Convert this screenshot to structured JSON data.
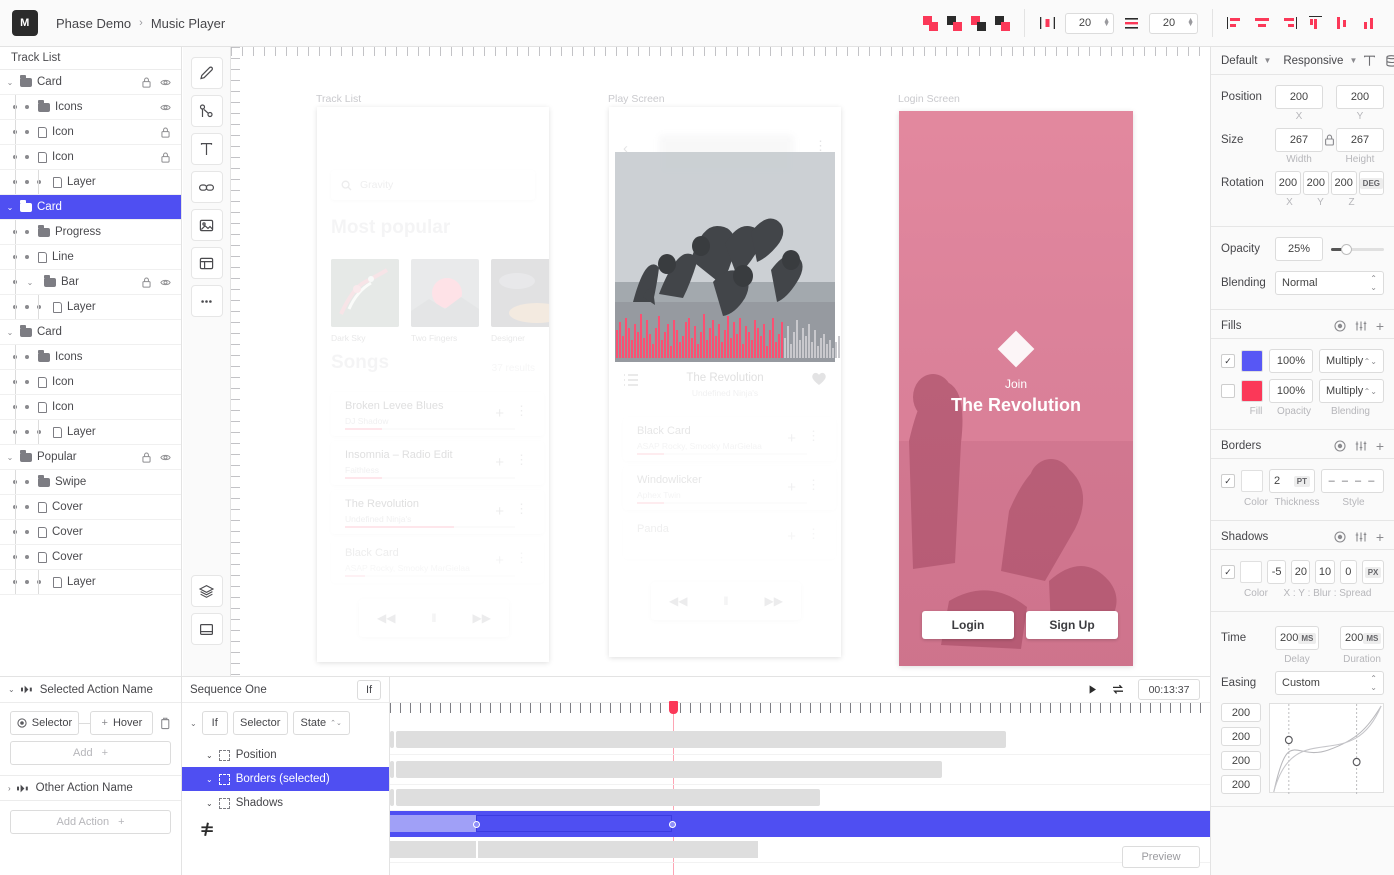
{
  "app": {
    "logo": "M",
    "breadcrumb": [
      "Phase Demo",
      "Music Player"
    ],
    "separator": "›"
  },
  "toolbar": {
    "boolean_ops": [
      "union-icon",
      "subtract-icon",
      "intersect-icon",
      "exclude-icon"
    ],
    "spacing_h": "20",
    "spacing_v": "20",
    "align_icons": [
      "align-left-icon",
      "align-center-h-icon",
      "align-right-icon",
      "align-top-icon",
      "align-middle-v-icon",
      "align-bottom-icon"
    ]
  },
  "layers": {
    "title": "Track List",
    "items": [
      {
        "label": "Card",
        "type": "folder",
        "depth": 0,
        "caret": "⌄",
        "lock": true,
        "eye": true
      },
      {
        "label": "Icons",
        "type": "folder",
        "depth": 1,
        "caret": "",
        "lock": false,
        "eye": true
      },
      {
        "label": "Icon",
        "type": "page",
        "depth": 1,
        "caret": "",
        "lock": true,
        "eye": false
      },
      {
        "label": "Icon",
        "type": "page",
        "depth": 1,
        "caret": "",
        "lock": true,
        "eye": false
      },
      {
        "label": "Layer",
        "type": "page",
        "depth": 2,
        "caret": "",
        "lock": false,
        "eye": false
      },
      {
        "label": "Card",
        "type": "folder",
        "depth": 0,
        "caret": "⌄",
        "lock": false,
        "eye": false,
        "selected": true
      },
      {
        "label": "Progress",
        "type": "folder",
        "depth": 1,
        "caret": "",
        "lock": false,
        "eye": false
      },
      {
        "label": "Line",
        "type": "page",
        "depth": 1,
        "caret": "",
        "lock": false,
        "eye": false
      },
      {
        "label": "Bar",
        "type": "folder",
        "depth": 1,
        "caret": "⌄",
        "lock": true,
        "eye": true
      },
      {
        "label": "Layer",
        "type": "page",
        "depth": 2,
        "caret": "",
        "lock": false,
        "eye": false
      },
      {
        "label": "Card",
        "type": "folder",
        "depth": 0,
        "caret": "⌄",
        "lock": false,
        "eye": false
      },
      {
        "label": "Icons",
        "type": "folder",
        "depth": 1,
        "caret": "",
        "lock": false,
        "eye": false
      },
      {
        "label": "Icon",
        "type": "page",
        "depth": 1,
        "caret": "",
        "lock": false,
        "eye": false
      },
      {
        "label": "Icon",
        "type": "page",
        "depth": 1,
        "caret": "",
        "lock": false,
        "eye": false
      },
      {
        "label": "Layer",
        "type": "page",
        "depth": 2,
        "caret": "",
        "lock": false,
        "eye": false
      },
      {
        "label": "Popular",
        "type": "folder",
        "depth": 0,
        "caret": "⌄",
        "lock": true,
        "eye": true
      },
      {
        "label": "Swipe",
        "type": "folder",
        "depth": 1,
        "caret": "",
        "lock": false,
        "eye": false
      },
      {
        "label": "Cover",
        "type": "page",
        "depth": 1,
        "caret": "",
        "lock": false,
        "eye": false
      },
      {
        "label": "Cover",
        "type": "page",
        "depth": 1,
        "caret": "",
        "lock": false,
        "eye": false
      },
      {
        "label": "Cover",
        "type": "page",
        "depth": 1,
        "caret": "",
        "lock": false,
        "eye": false
      },
      {
        "label": "Layer",
        "type": "page",
        "depth": 2,
        "caret": "",
        "lock": false,
        "eye": false
      }
    ]
  },
  "tools": [
    {
      "name": "pen-tool-icon"
    },
    {
      "name": "node-path-tool-icon"
    },
    {
      "name": "text-tool-icon"
    },
    {
      "name": "link-tool-icon"
    },
    {
      "name": "image-tool-icon"
    },
    {
      "name": "frame-tool-icon"
    },
    {
      "name": "more-tools-icon"
    }
  ],
  "tools_lower": [
    {
      "name": "layers-icon"
    },
    {
      "name": "artboard-icon"
    }
  ],
  "canvas": {
    "artboards": [
      {
        "label": "Track List"
      },
      {
        "label": "Play Screen"
      },
      {
        "label": "Login Screen"
      }
    ],
    "track_list": {
      "search_placeholder": "Gravity",
      "section_popular": "Most popular",
      "section_songs": "Songs",
      "results": "37 results",
      "albums": [
        {
          "caption": "Dark Sky"
        },
        {
          "caption": "Two Fingers"
        },
        {
          "caption": "Designer"
        }
      ],
      "songs": [
        {
          "title": "Broken Levee Blues",
          "artist": "DJ Shadow",
          "progress": 22
        },
        {
          "title": "Insomnia – Radio Edit",
          "artist": "Faithless",
          "progress": 22
        },
        {
          "title": "The Revolution",
          "artist": "Undefined Ninja's",
          "progress": 64
        },
        {
          "title": "Black Card",
          "artist": "ASAP Rocky, Smooky MarGielaa",
          "progress": 12
        }
      ],
      "player": {
        "prev": "◀◀",
        "pause": "‖",
        "next": "▶▶"
      }
    },
    "play_screen": {
      "back": "‹",
      "more": "⋮",
      "track_title": "The Revolution",
      "track_artist": "Undefined Ninja's",
      "queue_icon": "queue-list-icon",
      "like_icon": "heart-icon",
      "songs": [
        {
          "title": "Black Card",
          "artist": "ASAP Rocky, Smooky MarGielaa",
          "progress": 16
        },
        {
          "title": "Windowlicker",
          "artist": "Aphex Twin",
          "progress": 16
        },
        {
          "title": "Panda",
          "artist": "",
          "progress": 0
        }
      ],
      "player": {
        "prev": "◀◀",
        "pause": "‖",
        "next": "▶▶"
      }
    },
    "login_screen": {
      "join": "Join",
      "title": "The Revolution",
      "login_button": "Login",
      "signup_button": "Sign Up"
    }
  },
  "properties": {
    "mode": "Default",
    "responsive": "Responsive",
    "position": {
      "label": "Position",
      "x": "200",
      "y": "200",
      "sub_x": "X",
      "sub_y": "Y"
    },
    "size": {
      "label": "Size",
      "width": "267",
      "height": "267",
      "sub_w": "Width",
      "sub_h": "Height"
    },
    "rotation": {
      "label": "Rotation",
      "x": "200",
      "y": "200",
      "z": "200",
      "unit": "DEG",
      "sub_x": "X",
      "sub_y": "Y",
      "sub_z": "Z"
    },
    "opacity": {
      "label": "Opacity",
      "value": "25%"
    },
    "blending": {
      "label": "Blending",
      "value": "Normal"
    },
    "fills": {
      "label": "Fills",
      "sub": {
        "fill": "Fill",
        "opacity": "Opacity",
        "blending": "Blending"
      },
      "items": [
        {
          "checked": true,
          "color": "#5757f5",
          "opacity": "100%",
          "blending": "Multiply"
        },
        {
          "checked": false,
          "color": "#fb3858",
          "opacity": "100%",
          "blending": "Multiply"
        }
      ]
    },
    "borders": {
      "label": "Borders",
      "sub": {
        "color": "Color",
        "thickness": "Thickness",
        "style": "Style"
      },
      "checked": true,
      "color": "#ffffff",
      "thickness": "2",
      "unit": "PT",
      "style": "– – – –"
    },
    "shadows": {
      "label": "Shadows",
      "sub": {
        "color": "Color",
        "values": "X : Y : Blur : Spread"
      },
      "checked": true,
      "color": "#ffffff",
      "x": "-5",
      "y": "20",
      "blur": "10",
      "spread": "0",
      "unit": "PX"
    },
    "time": {
      "label": "Time",
      "delay": "200",
      "duration": "200",
      "unit": "MS",
      "sub_delay": "Delay",
      "sub_duration": "Duration"
    },
    "easing": {
      "label": "Easing",
      "value": "Custom",
      "values": [
        "200",
        "200",
        "200",
        "200"
      ]
    }
  },
  "timeline": {
    "actions": {
      "selected_action": "Selected Action Name",
      "selector": "Selector",
      "hover": "Hover",
      "add": "Add",
      "other_action": "Other Action Name",
      "add_action": "Add Action"
    },
    "sequence": {
      "name": "Sequence One",
      "if_label": "If",
      "condition": {
        "if": "If",
        "selector": "Selector",
        "state": "State"
      },
      "tracks": [
        {
          "label": "Position",
          "selected": false
        },
        {
          "label": "Borders (selected)",
          "selected": true
        },
        {
          "label": "Shadows",
          "selected": false
        }
      ]
    },
    "time_display": "00:13:37",
    "play_icon": "play-icon",
    "loop_icon": "loop-icon",
    "preview_button": "Preview"
  }
}
